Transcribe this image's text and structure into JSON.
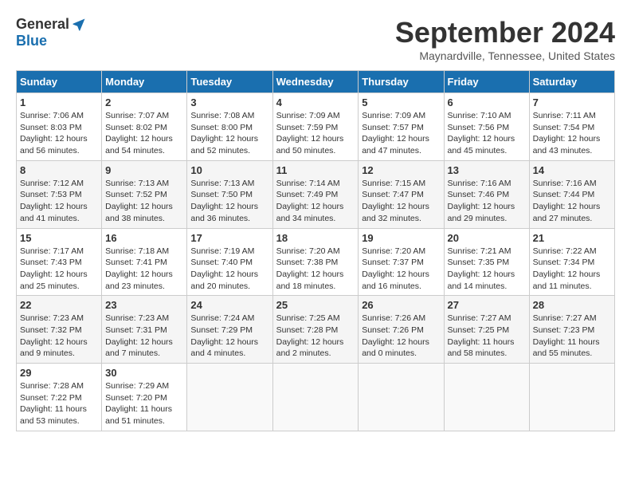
{
  "header": {
    "logo_general": "General",
    "logo_blue": "Blue",
    "month_title": "September 2024",
    "location": "Maynardville, Tennessee, United States"
  },
  "weekdays": [
    "Sunday",
    "Monday",
    "Tuesday",
    "Wednesday",
    "Thursday",
    "Friday",
    "Saturday"
  ],
  "weeks": [
    [
      {
        "day": "1",
        "info": "Sunrise: 7:06 AM\nSunset: 8:03 PM\nDaylight: 12 hours\nand 56 minutes."
      },
      {
        "day": "2",
        "info": "Sunrise: 7:07 AM\nSunset: 8:02 PM\nDaylight: 12 hours\nand 54 minutes."
      },
      {
        "day": "3",
        "info": "Sunrise: 7:08 AM\nSunset: 8:00 PM\nDaylight: 12 hours\nand 52 minutes."
      },
      {
        "day": "4",
        "info": "Sunrise: 7:09 AM\nSunset: 7:59 PM\nDaylight: 12 hours\nand 50 minutes."
      },
      {
        "day": "5",
        "info": "Sunrise: 7:09 AM\nSunset: 7:57 PM\nDaylight: 12 hours\nand 47 minutes."
      },
      {
        "day": "6",
        "info": "Sunrise: 7:10 AM\nSunset: 7:56 PM\nDaylight: 12 hours\nand 45 minutes."
      },
      {
        "day": "7",
        "info": "Sunrise: 7:11 AM\nSunset: 7:54 PM\nDaylight: 12 hours\nand 43 minutes."
      }
    ],
    [
      {
        "day": "8",
        "info": "Sunrise: 7:12 AM\nSunset: 7:53 PM\nDaylight: 12 hours\nand 41 minutes."
      },
      {
        "day": "9",
        "info": "Sunrise: 7:13 AM\nSunset: 7:52 PM\nDaylight: 12 hours\nand 38 minutes."
      },
      {
        "day": "10",
        "info": "Sunrise: 7:13 AM\nSunset: 7:50 PM\nDaylight: 12 hours\nand 36 minutes."
      },
      {
        "day": "11",
        "info": "Sunrise: 7:14 AM\nSunset: 7:49 PM\nDaylight: 12 hours\nand 34 minutes."
      },
      {
        "day": "12",
        "info": "Sunrise: 7:15 AM\nSunset: 7:47 PM\nDaylight: 12 hours\nand 32 minutes."
      },
      {
        "day": "13",
        "info": "Sunrise: 7:16 AM\nSunset: 7:46 PM\nDaylight: 12 hours\nand 29 minutes."
      },
      {
        "day": "14",
        "info": "Sunrise: 7:16 AM\nSunset: 7:44 PM\nDaylight: 12 hours\nand 27 minutes."
      }
    ],
    [
      {
        "day": "15",
        "info": "Sunrise: 7:17 AM\nSunset: 7:43 PM\nDaylight: 12 hours\nand 25 minutes."
      },
      {
        "day": "16",
        "info": "Sunrise: 7:18 AM\nSunset: 7:41 PM\nDaylight: 12 hours\nand 23 minutes."
      },
      {
        "day": "17",
        "info": "Sunrise: 7:19 AM\nSunset: 7:40 PM\nDaylight: 12 hours\nand 20 minutes."
      },
      {
        "day": "18",
        "info": "Sunrise: 7:20 AM\nSunset: 7:38 PM\nDaylight: 12 hours\nand 18 minutes."
      },
      {
        "day": "19",
        "info": "Sunrise: 7:20 AM\nSunset: 7:37 PM\nDaylight: 12 hours\nand 16 minutes."
      },
      {
        "day": "20",
        "info": "Sunrise: 7:21 AM\nSunset: 7:35 PM\nDaylight: 12 hours\nand 14 minutes."
      },
      {
        "day": "21",
        "info": "Sunrise: 7:22 AM\nSunset: 7:34 PM\nDaylight: 12 hours\nand 11 minutes."
      }
    ],
    [
      {
        "day": "22",
        "info": "Sunrise: 7:23 AM\nSunset: 7:32 PM\nDaylight: 12 hours\nand 9 minutes."
      },
      {
        "day": "23",
        "info": "Sunrise: 7:23 AM\nSunset: 7:31 PM\nDaylight: 12 hours\nand 7 minutes."
      },
      {
        "day": "24",
        "info": "Sunrise: 7:24 AM\nSunset: 7:29 PM\nDaylight: 12 hours\nand 4 minutes."
      },
      {
        "day": "25",
        "info": "Sunrise: 7:25 AM\nSunset: 7:28 PM\nDaylight: 12 hours\nand 2 minutes."
      },
      {
        "day": "26",
        "info": "Sunrise: 7:26 AM\nSunset: 7:26 PM\nDaylight: 12 hours\nand 0 minutes."
      },
      {
        "day": "27",
        "info": "Sunrise: 7:27 AM\nSunset: 7:25 PM\nDaylight: 11 hours\nand 58 minutes."
      },
      {
        "day": "28",
        "info": "Sunrise: 7:27 AM\nSunset: 7:23 PM\nDaylight: 11 hours\nand 55 minutes."
      }
    ],
    [
      {
        "day": "29",
        "info": "Sunrise: 7:28 AM\nSunset: 7:22 PM\nDaylight: 11 hours\nand 53 minutes."
      },
      {
        "day": "30",
        "info": "Sunrise: 7:29 AM\nSunset: 7:20 PM\nDaylight: 11 hours\nand 51 minutes."
      },
      {
        "day": "",
        "info": ""
      },
      {
        "day": "",
        "info": ""
      },
      {
        "day": "",
        "info": ""
      },
      {
        "day": "",
        "info": ""
      },
      {
        "day": "",
        "info": ""
      }
    ]
  ]
}
